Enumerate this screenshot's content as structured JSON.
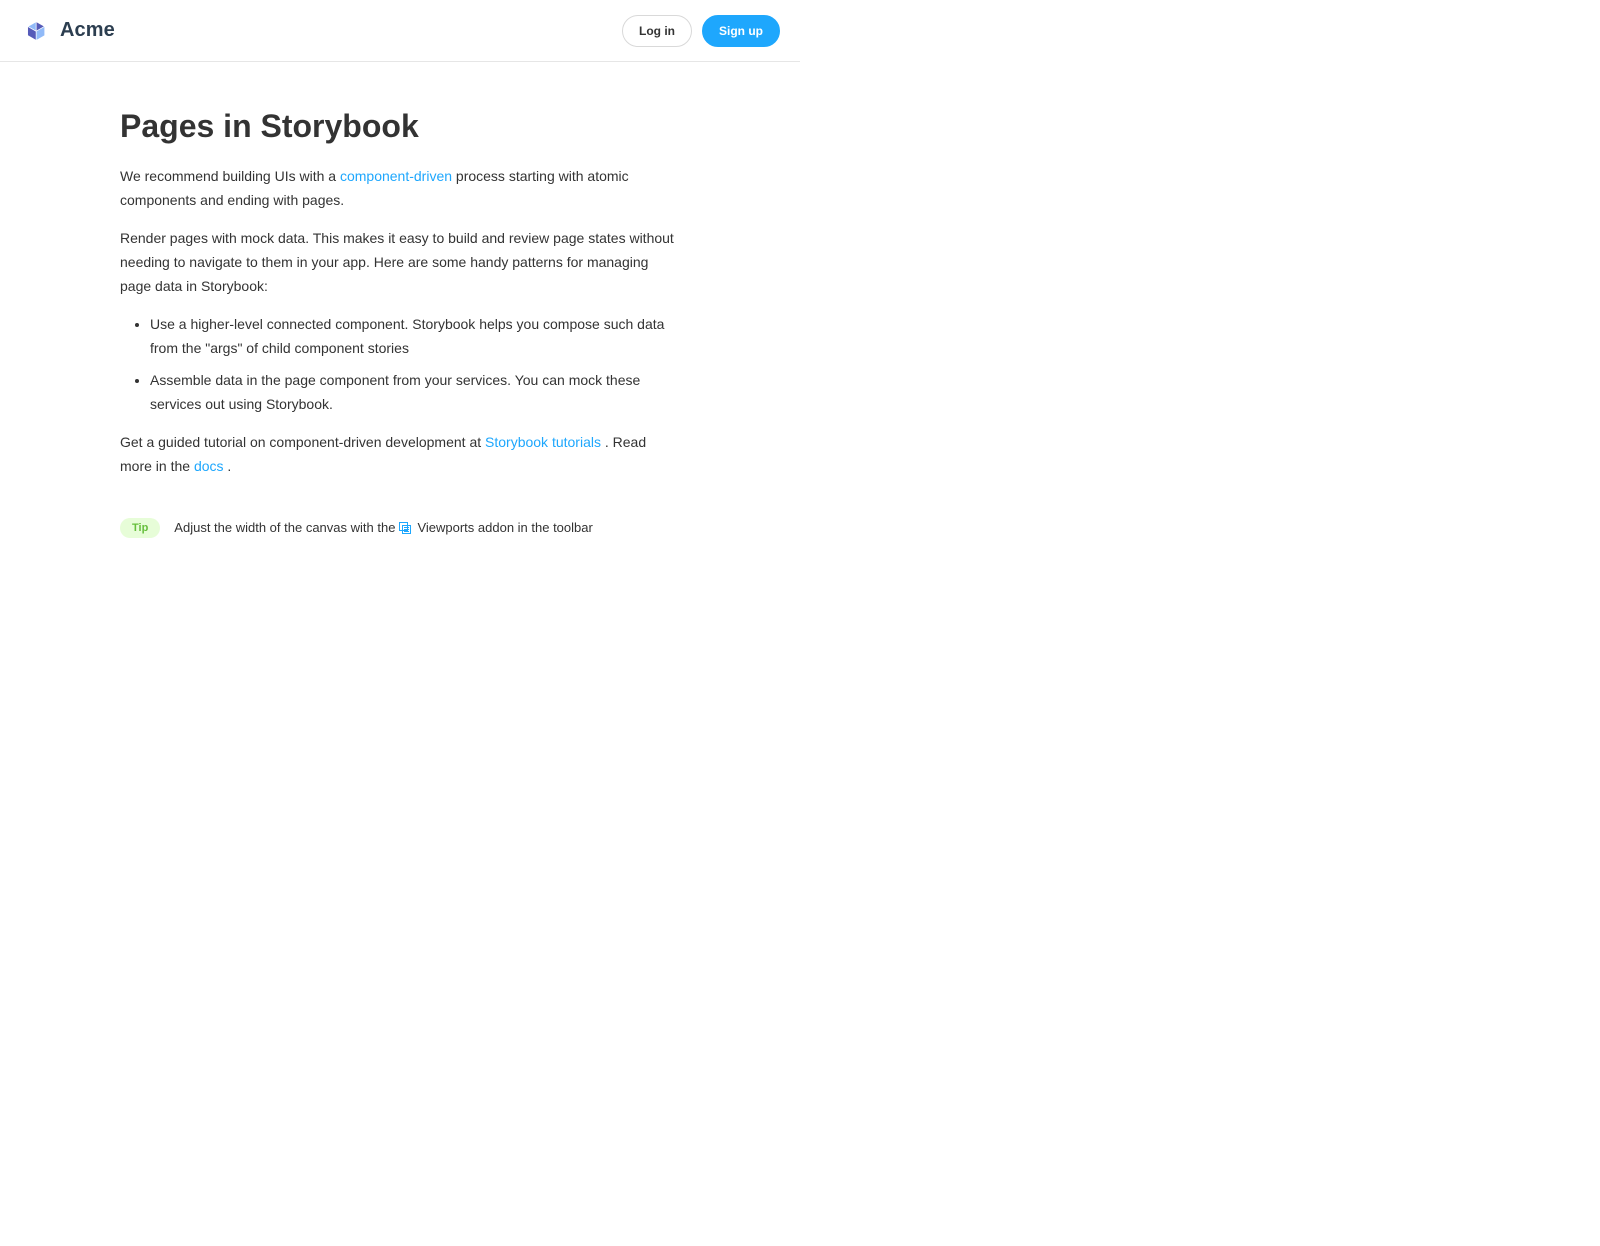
{
  "header": {
    "brand_name": "Acme",
    "login_label": "Log in",
    "signup_label": "Sign up"
  },
  "page": {
    "title": "Pages in Storybook",
    "intro_before": "We recommend building UIs with a ",
    "intro_link": "component-driven",
    "intro_after": " process starting with atomic components and ending with pages.",
    "mock_paragraph": "Render pages with mock data. This makes it easy to build and review page states without needing to navigate to them in your app. Here are some handy patterns for managing page data in Storybook:",
    "patterns": [
      "Use a higher-level connected component. Storybook helps you compose such data from the \"args\" of child component stories",
      "Assemble data in the page component from your services. You can mock these services out using Storybook."
    ],
    "tutorial_before": "Get a guided tutorial on component-driven development at ",
    "tutorial_link": "Storybook tutorials",
    "tutorial_middle": " . Read more in the ",
    "docs_link": "docs",
    "tutorial_end": " ."
  },
  "tip": {
    "badge": "Tip",
    "text_before": "Adjust the width of the canvas with the",
    "text_after": "Viewports addon in the toolbar",
    "icon": "viewport-icon"
  },
  "colors": {
    "accent": "#1ea7fd",
    "tip_background": "#e7fdd8",
    "tip_text": "#66bf3c",
    "brand_text": "#2c3e50",
    "logo_dark": "#555ab9",
    "logo_mid": "#91baf8",
    "logo_light": "#6870e0"
  }
}
